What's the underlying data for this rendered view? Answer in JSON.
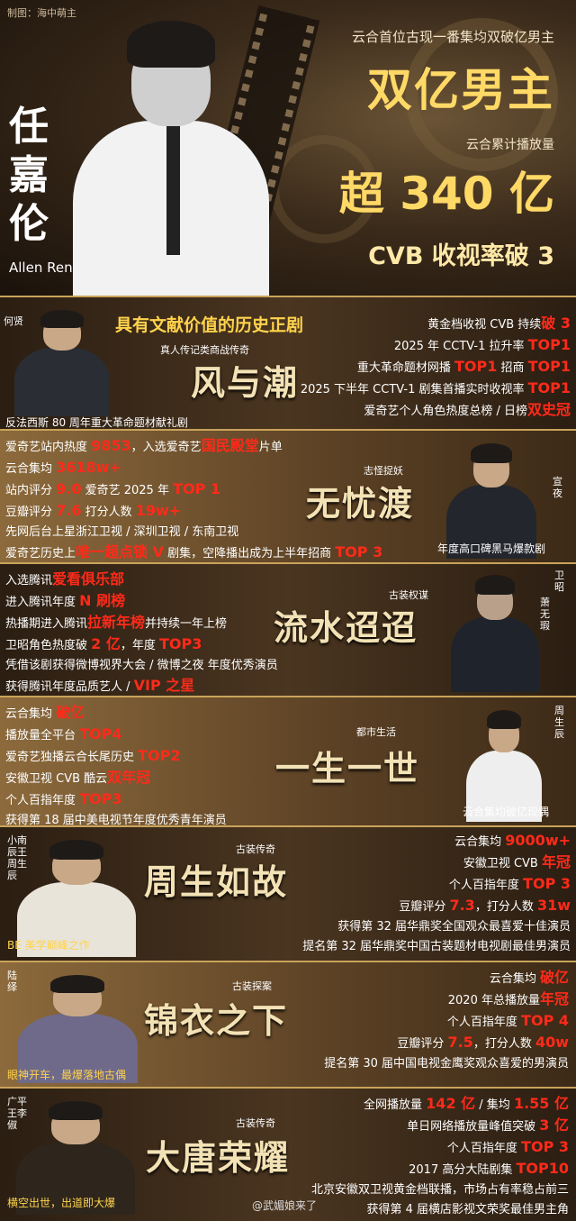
{
  "hero": {
    "credit": "制图：海中萌主",
    "name_zh": "任嘉伦",
    "name_en": "Allen Ren",
    "subtitle1": "云合首位古现一番集均双破亿男主",
    "headline1": "双亿男主",
    "subtitle2": "云合累计播放量",
    "headline2": "超 340 亿",
    "headline3": "CVB 收视率破 3"
  },
  "sections": [
    {
      "id": "fengyuchao",
      "top_label": "具有文献价值的历史正剧",
      "genre": "真人传记类商战传奇",
      "title": "风与潮",
      "role": "何贤",
      "caption": "反法西斯 80 周年重大革命题材献礼剧",
      "lines": [
        [
          "黄金档收视 CVB 持续",
          "破 3"
        ],
        [
          "2025 年 CCTV-1 拉升率 ",
          "TOP1"
        ],
        [
          "重大革命题材网播 ",
          "TOP1",
          " 招商 ",
          "TOP1"
        ],
        [
          "2025 下半年 CCTV-1 剧集首播实时收视率 ",
          "TOP1"
        ],
        [
          "爱奇艺个人角色热度总榜 / 日榜",
          "双史冠"
        ]
      ]
    },
    {
      "id": "wuyoudu",
      "genre": "志怪捉妖",
      "title": "无忧渡",
      "role": "宣夜",
      "caption": "年度高口碑黑马爆款剧",
      "lines": [
        [
          "爱奇艺站内热度 ",
          "9853",
          "，入选爱奇艺",
          "国民殿堂",
          "片单"
        ],
        [
          "云合集均 ",
          "3618w+"
        ],
        [
          "站内评分 ",
          "9.0",
          " 爱奇艺 2025 年 ",
          "TOP 1"
        ],
        [
          "豆瓣评分 ",
          "7.6",
          " 打分人数 ",
          "19w+"
        ],
        [
          "先网后台上星浙江卫视 / 深圳卫视 / 东南卫视"
        ],
        [
          "爱奇艺历史上",
          "唯一超点锁 V",
          " 剧集，空降播出成为上半年招商 ",
          "TOP 3"
        ]
      ]
    },
    {
      "id": "liushui",
      "genre": "古装权谋",
      "title": "流水迢迢",
      "role": "卫昭",
      "role2": "萧无瑕",
      "lines": [
        [
          "入选腾讯",
          "爱看俱乐部"
        ],
        [
          "进入腾讯年度 ",
          "N 刷榜"
        ],
        [
          "热播期进入腾讯",
          "拉新年榜",
          "并持续一年上榜"
        ],
        [
          "卫昭角色热度破 ",
          "2 亿",
          "，年度 ",
          "TOP3"
        ],
        [
          "凭借该剧获得微博视界大会 / 微博之夜 年度优秀演员"
        ],
        [
          "获得腾讯年度品质艺人 / ",
          "VIP 之星"
        ]
      ]
    },
    {
      "id": "yishengyishi",
      "genre": "都市生活",
      "title": "一生一世",
      "role": "周生辰",
      "caption": "云合集均破亿现偶",
      "lines": [
        [
          "云合集均 ",
          "破亿"
        ],
        [
          "播放量全平台 ",
          "TOP4"
        ],
        [
          "爱奇艺独播云合长尾历史 ",
          "TOP2"
        ],
        [
          "安徽卫视 CVB 酷云",
          "双年冠"
        ],
        [
          "个人百指年度 ",
          "TOP3"
        ],
        [
          "获得第 18 届中美电视节年度优秀青年演员"
        ]
      ]
    },
    {
      "id": "zhoushengrugu",
      "genre": "古装传奇",
      "title": "周生如故",
      "role": "小南辰王周生辰",
      "caption": "BE 美学巅峰之作",
      "lines": [
        [
          "云合集均 ",
          "9000w+"
        ],
        [
          "安徽卫视 CVB ",
          "年冠"
        ],
        [
          "个人百指年度 ",
          "TOP 3"
        ],
        [
          "豆瓣评分 ",
          "7.3",
          "，打分人数 ",
          "31w"
        ],
        [
          "获得第 32 届华鼎奖全国观众最喜爱十佳演员"
        ],
        [
          "提名第 32 届华鼎奖中国古装题材电视剧最佳男演员"
        ]
      ]
    },
    {
      "id": "jinyizhixia",
      "genre": "古装探案",
      "title": "锦衣之下",
      "role": "陆绎",
      "caption": "眼神开车，最爆落地古偶",
      "lines": [
        [
          "云合集均 ",
          "破亿"
        ],
        [
          "2020 年总播放量",
          "年冠"
        ],
        [
          "个人百指年度 ",
          "TOP 4"
        ],
        [
          "豆瓣评分 ",
          "7.5",
          "，打分人数 ",
          "40w"
        ],
        [
          "提名第 30 届中国电视金鹰奖观众喜爱的男演员"
        ]
      ]
    },
    {
      "id": "datang",
      "genre": "古装传奇",
      "title": "大唐荣耀",
      "role": "广平王李俶",
      "caption": "横空出世，出道即大爆",
      "lines": [
        [
          "全网播放量 ",
          "142 亿",
          " / 集均 ",
          "1.55 亿"
        ],
        [
          "单日网络播放量峰值突破 ",
          "3 亿"
        ],
        [
          "个人百指年度 ",
          "TOP 3"
        ],
        [
          "2017 高分大陆剧集 ",
          "TOP10"
        ],
        [
          "北京安徽双卫视黄金档联播，市场占有率稳占前三"
        ],
        [
          "获得第 4 届横店影视文荣奖最佳男主角"
        ]
      ]
    }
  ],
  "footer": "@武媚娘来了"
}
